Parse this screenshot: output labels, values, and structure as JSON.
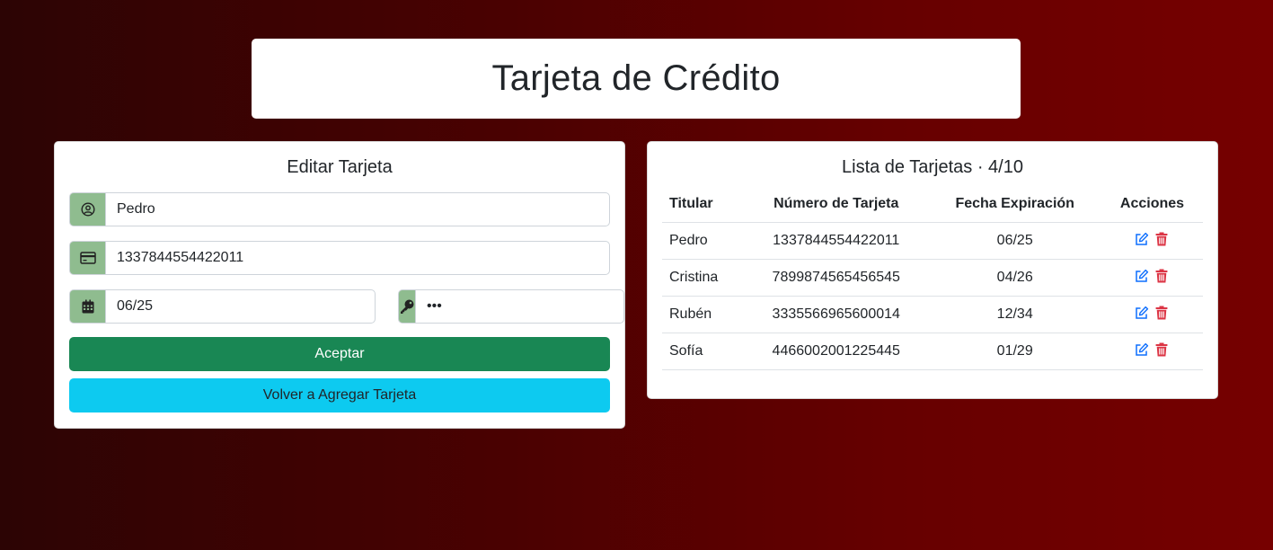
{
  "header": {
    "title": "Tarjeta de Crédito"
  },
  "form": {
    "title": "Editar Tarjeta",
    "holder_value": "Pedro",
    "number_value": "1337844554422011",
    "expiry_value": "06/25",
    "cvv_value": "•••",
    "accept_label": "Aceptar",
    "back_label": "Volver a Agregar Tarjeta",
    "icons": [
      "user-circle-icon",
      "credit-card-icon",
      "calendar-icon",
      "key-icon"
    ]
  },
  "list": {
    "title": "Lista de Tarjetas · 4/10",
    "columns": [
      "Titular",
      "Número de Tarjeta",
      "Fecha Expiración",
      "Acciones"
    ],
    "rows": [
      {
        "holder": "Pedro",
        "number": "1337844554422011",
        "expiry": "06/25"
      },
      {
        "holder": "Cristina",
        "number": "7899874565456545",
        "expiry": "04/26"
      },
      {
        "holder": "Rubén",
        "number": "3335566965600014",
        "expiry": "12/34"
      },
      {
        "holder": "Sofía",
        "number": "4466002001225445",
        "expiry": "01/29"
      }
    ]
  },
  "colors": {
    "addon": "#8fbc8f",
    "accept": "#198754",
    "back": "#0dcaf0",
    "edit": "#0d6efd",
    "delete": "#dc3545"
  }
}
